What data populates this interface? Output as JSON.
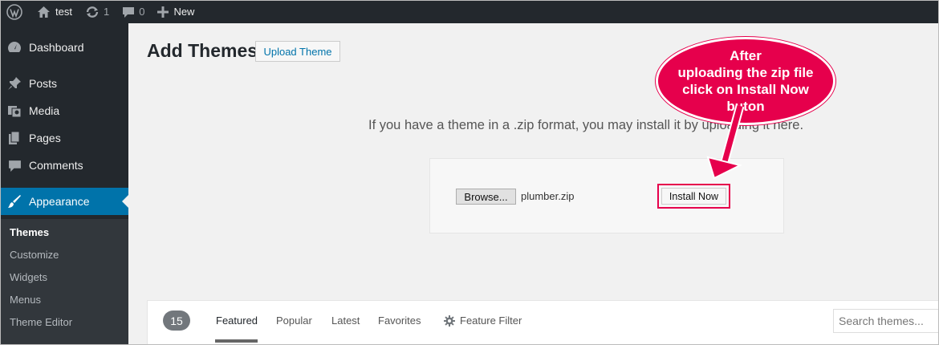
{
  "admin_bar": {
    "site_name": "test",
    "updates_count": "1",
    "comments_count": "0",
    "new_label": "New"
  },
  "sidebar": {
    "items": [
      {
        "label": "Dashboard",
        "icon": "dashboard-icon"
      },
      {
        "label": "Posts",
        "icon": "pin-icon"
      },
      {
        "label": "Media",
        "icon": "media-icon"
      },
      {
        "label": "Pages",
        "icon": "pages-icon"
      },
      {
        "label": "Comments",
        "icon": "comment-icon"
      },
      {
        "label": "Appearance",
        "icon": "brush-icon",
        "current": true
      }
    ],
    "submenu": [
      "Themes",
      "Customize",
      "Widgets",
      "Menus",
      "Theme Editor"
    ]
  },
  "main": {
    "title": "Add Themes",
    "upload_button": "Upload Theme",
    "upload_description": "If you have a theme in a .zip format, you may install it by uploading it here.",
    "browse_button": "Browse...",
    "file_name": "plumber.zip",
    "install_button": "Install Now"
  },
  "callout": {
    "lines": [
      "After",
      "uploading the zip file",
      "click on Install Now",
      "buton"
    ]
  },
  "filter_bar": {
    "count": "15",
    "tabs": [
      "Featured",
      "Popular",
      "Latest",
      "Favorites"
    ],
    "feature_filter": "Feature Filter",
    "search_placeholder": "Search themes..."
  },
  "colors": {
    "admin_bg": "#23282d",
    "accent": "#0073aa",
    "callout": "#e6004c",
    "page_bg": "#f1f1f1"
  }
}
